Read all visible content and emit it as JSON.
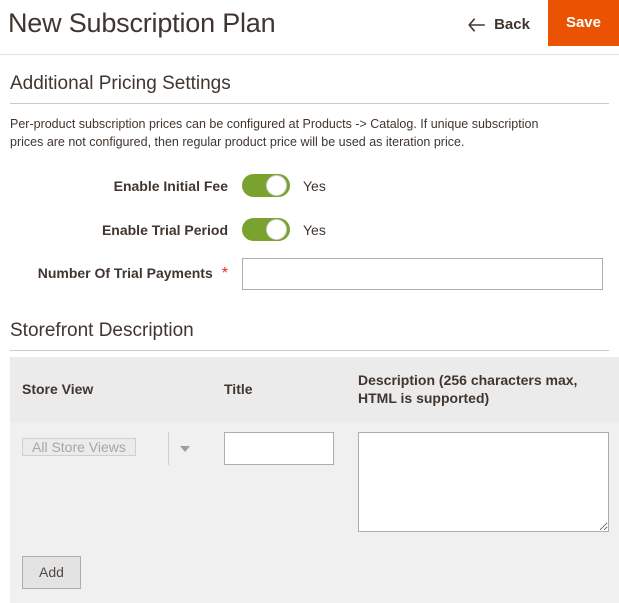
{
  "header": {
    "title": "New Subscription Plan",
    "back_label": "Back",
    "save_label": "Save",
    "save_color": "#eb5202"
  },
  "pricing_section": {
    "title": "Additional Pricing Settings",
    "note": "Per-product subscription prices can be configured at Products -> Catalog. If unique subscription prices are not configured, then regular product price will be used as iteration price.",
    "fields": [
      {
        "label": "Enable Initial Fee",
        "type": "toggle",
        "value": "Yes",
        "state": "on",
        "on_color": "#79a22e"
      },
      {
        "label": "Enable Trial Period",
        "type": "toggle",
        "value": "Yes",
        "state": "on",
        "on_color": "#79a22e"
      },
      {
        "label": "Number Of Trial Payments",
        "type": "text",
        "required": true,
        "required_marker": "*",
        "required_color": "#e02b27",
        "value": "",
        "placeholder": ""
      }
    ]
  },
  "storefront_section": {
    "title": "Storefront Description",
    "table": {
      "columns": [
        "Store View",
        "Title",
        "Description (256 characters max, HTML is supported)"
      ],
      "rows": [
        {
          "store_view": "All Store Views",
          "store_view_disabled": true,
          "title": "",
          "description": ""
        }
      ],
      "add_label": "Add"
    }
  }
}
